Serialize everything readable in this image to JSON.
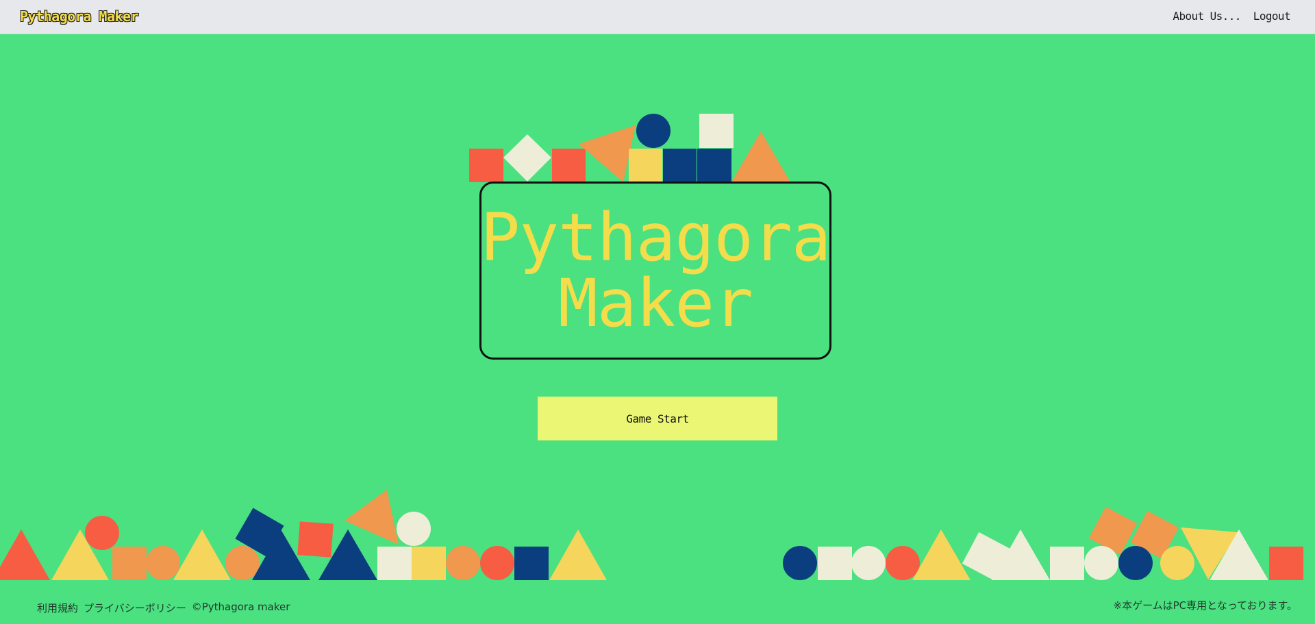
{
  "header": {
    "brand": "Pythagora Maker",
    "nav": {
      "about": "About Us...",
      "logout": "Logout"
    }
  },
  "hero": {
    "title_line1": "Pythagora",
    "title_line2": "Maker",
    "start_label": "Game Start"
  },
  "footer": {
    "terms": "利用規約",
    "privacy": "プライバシーポリシー",
    "copyright": "©Pythagora maker",
    "notice": "※本ゲームはPC専用となっております。"
  },
  "colors": {
    "background": "#4be080",
    "accent_yellow": "#f3dd4a",
    "button": "#eaf674",
    "red": "#f65d43",
    "orange": "#f0984d",
    "cream": "#eeeed8",
    "navy": "#0b3e7e",
    "yellow": "#f6d55c"
  },
  "decor_icons": [
    "square-icon",
    "circle-icon",
    "triangle-icon",
    "diamond-icon"
  ]
}
